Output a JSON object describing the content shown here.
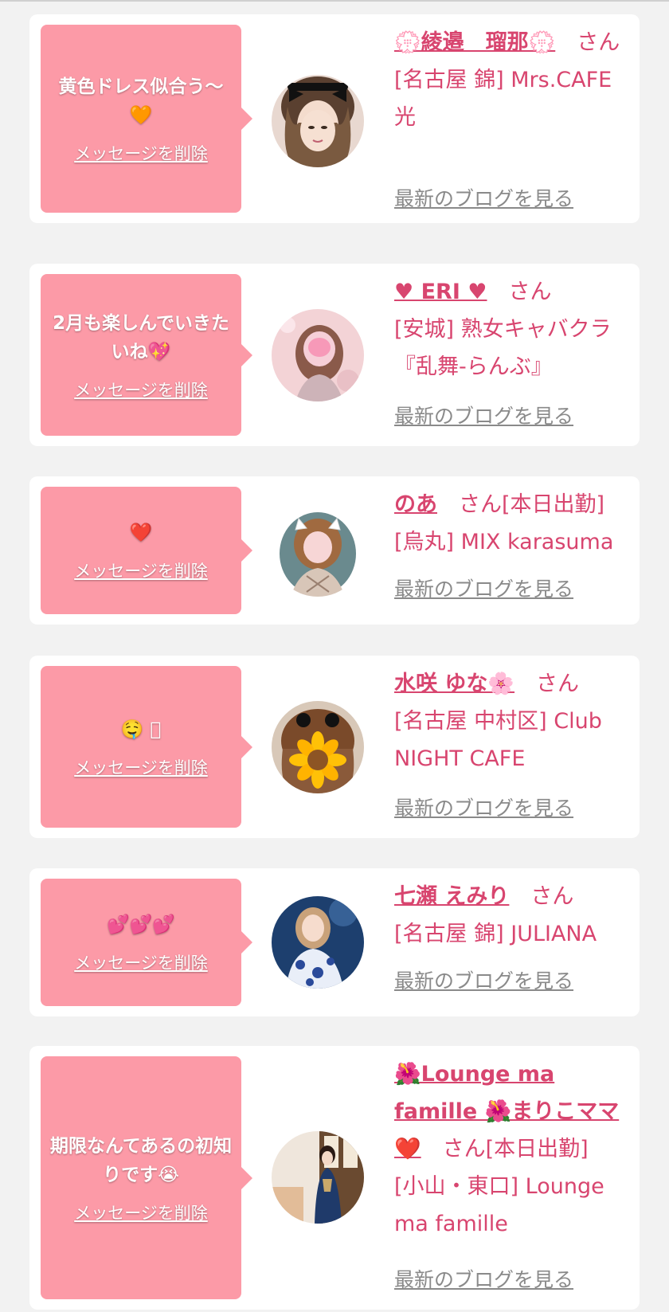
{
  "colors": {
    "background": "#f2f2f2",
    "bubble": "#fc9aa7",
    "accent": "#d8456f",
    "link_gray": "#8a8a8a"
  },
  "cards": [
    {
      "message": "黄色ドレス似合う〜🧡",
      "delete_label": "メッセージを削除",
      "name": "💮綾邉　瑠那💮",
      "suffix": "さん",
      "shop": "[名古屋 錦] Mrs.CAFE 光",
      "blog_label": "最新のブログを見る",
      "avatar_icon": "avatar-woman-black-hair-ribbon"
    },
    {
      "message": "2月も楽しんでいきたいね💖",
      "delete_label": "メッセージを削除",
      "name": "♥ ERI ♥",
      "suffix": "さん",
      "shop": "[安城] 熟女キャバクラ『乱舞-らんぶ』",
      "blog_label": "最新のブログを見る",
      "avatar_icon": "avatar-woman-blurred-pink"
    },
    {
      "message": "❤️",
      "delete_label": "メッセージを削除",
      "name": "のあ",
      "suffix": "さん[本日出勤]",
      "shop": "[烏丸] MIX karasuma",
      "blog_label": "最新のブログを見る",
      "avatar_icon": "avatar-woman-bunny-ears"
    },
    {
      "message": "🤤 ⃞",
      "delete_label": "メッセージを削除",
      "name": "水咲 ゆな🌸",
      "suffix": "さん",
      "shop": "[名古屋 中村区] Club NIGHT CAFE",
      "blog_label": "最新のブログを見る",
      "avatar_icon": "avatar-sunflower-face"
    },
    {
      "message": "💕💕💕",
      "delete_label": "メッセージを削除",
      "name": "七瀬 えみり",
      "suffix": "さん",
      "shop": "[名古屋 錦] JULIANA",
      "blog_label": "最新のブログを見る",
      "avatar_icon": "avatar-woman-blue-dress"
    },
    {
      "message": "期限なんてあるの初知りです😭",
      "delete_label": "メッセージを削除",
      "name": "🌺Lounge ma famille 🌺まりこママ❤️",
      "suffix": "さん[本日出勤]",
      "shop": "[小山・東口] Lounge ma famille",
      "blog_label": "最新のブログを見る",
      "avatar_icon": "avatar-woman-kimono"
    }
  ]
}
